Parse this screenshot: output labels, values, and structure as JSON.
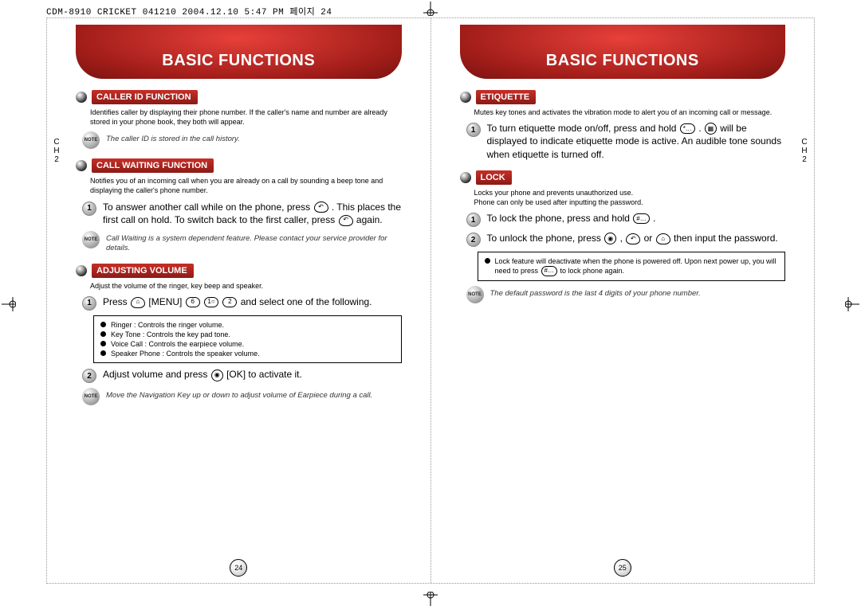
{
  "docHeader": "CDM-8910 CRICKET 041210  2004.12.10 5:47 PM 페이지 24",
  "bannerTitle": "BASIC FUNCTIONS",
  "sideChapterLabel": "C\nH\n2",
  "leftPage": {
    "number": "24",
    "sections": {
      "callerId": {
        "title": "CALLER ID FUNCTION",
        "desc": "Identifies caller by displaying their phone number.  If the caller's name and number are already stored in your phone book, they both will appear.",
        "note": "The caller ID is stored in the call history."
      },
      "callWaiting": {
        "title": "CALL WAITING FUNCTION",
        "desc": "Notifies you of an incoming call when you are already on a call by sounding a beep tone and displaying the caller's phone number.",
        "step1a": "To answer another call while on the phone, press ",
        "step1b": " . This places the first call on hold. To switch back to the first caller, press ",
        "step1c": " again.",
        "note": "Call Waiting is a system dependent feature. Please contact your service provider for details."
      },
      "volume": {
        "title": "ADJUSTING VOLUME",
        "desc": "Adjust the volume of the ringer, key beep and speaker.",
        "step1a": "Press ",
        "step1b": " [MENU] ",
        "step1c": " and select one of the following.",
        "box": {
          "r1": "Ringer : Controls the ringer volume.",
          "r2": "Key Tone : Controls the key pad tone.",
          "r3": "Voice Call : Controls the earpiece volume.",
          "r4": "Speaker Phone : Controls the speaker volume."
        },
        "step2a": "Adjust volume and press ",
        "step2b": " [OK] to activate it.",
        "note": "Move the Navigation Key up or down to adjust volume of Earpiece during a call."
      }
    }
  },
  "rightPage": {
    "number": "25",
    "sections": {
      "etiquette": {
        "title": "ETIQUETTE",
        "desc": "Mutes key tones and activates the vibration mode to alert you of an incoming call or message.",
        "step1a": "To turn etiquette mode on/off, press and hold",
        "step1b": " . ",
        "step1c": " will be displayed to indicate etiquette mode is active. An audible tone sounds when etiquette is turned off."
      },
      "lock": {
        "title": "LOCK",
        "desc": "Locks your phone and prevents unauthorized use.\nPhone can only be used after inputting the password.",
        "step1a": "To lock the phone, press and hold ",
        "step1b": " .",
        "step2a": "To unlock the phone, press ",
        "step2b": " , ",
        "step2c": " or ",
        "step2d": " then input the password.",
        "box1a": "Lock feature will deactivate when the phone is powered off. Upon next power up, you will need to press ",
        "box1b": " to lock phone again.",
        "note": "The default password is the last 4 digits of your phone number."
      }
    }
  },
  "keys": {
    "send": "↶",
    "menu": "⌂",
    "six": "6",
    "one": "1○",
    "two": "2",
    "ok": "◉",
    "star": "*…",
    "vibe": "▦",
    "hash": "#…",
    "end": "⏻"
  },
  "noteLabel": "NOTE"
}
